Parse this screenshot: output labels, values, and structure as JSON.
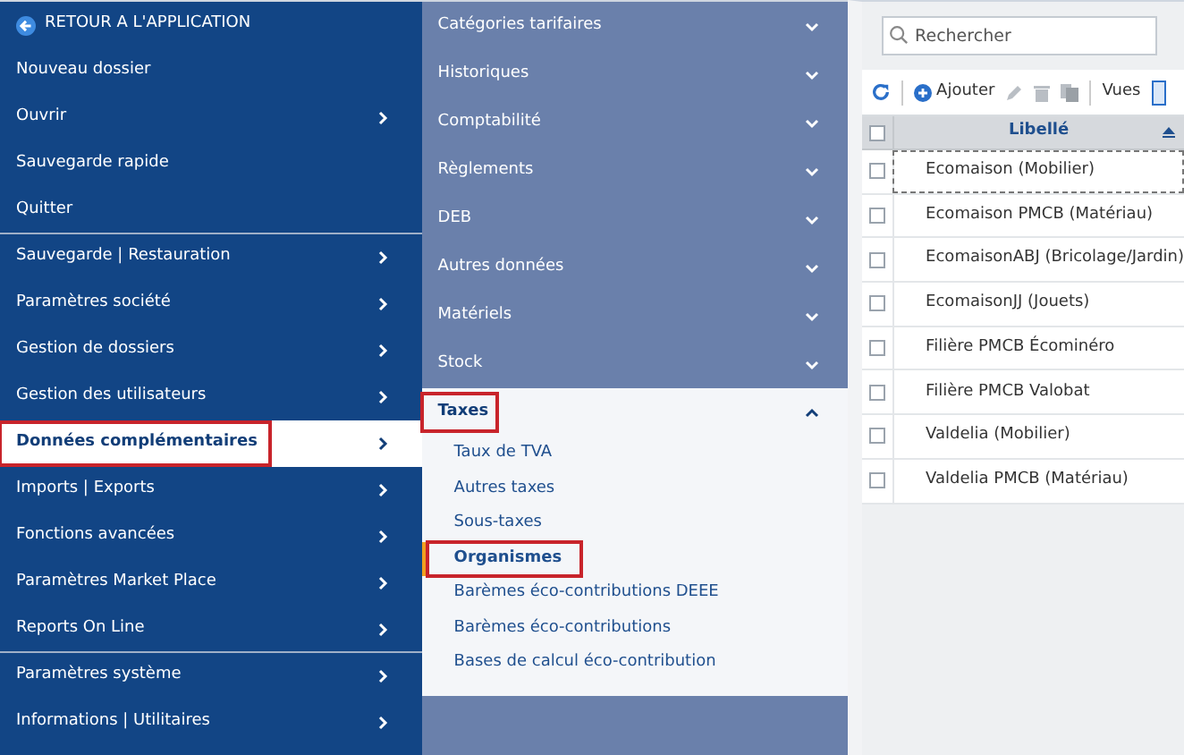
{
  "back_link": {
    "label": "RETOUR A L'APPLICATION"
  },
  "main_menu": [
    {
      "label": "Nouveau dossier",
      "has_submenu": false,
      "selected": false,
      "highlighted": false,
      "divider_after": false
    },
    {
      "label": "Ouvrir",
      "has_submenu": true,
      "selected": false,
      "highlighted": false,
      "divider_after": false
    },
    {
      "label": "Sauvegarde rapide",
      "has_submenu": false,
      "selected": false,
      "highlighted": false,
      "divider_after": false
    },
    {
      "label": "Quitter",
      "has_submenu": false,
      "selected": false,
      "highlighted": false,
      "divider_after": true
    },
    {
      "label": "Sauvegarde | Restauration",
      "has_submenu": true,
      "selected": false,
      "highlighted": false,
      "divider_after": false
    },
    {
      "label": "Paramètres société",
      "has_submenu": true,
      "selected": false,
      "highlighted": false,
      "divider_after": false
    },
    {
      "label": "Gestion de dossiers",
      "has_submenu": true,
      "selected": false,
      "highlighted": false,
      "divider_after": false
    },
    {
      "label": "Gestion des utilisateurs",
      "has_submenu": true,
      "selected": false,
      "highlighted": false,
      "divider_after": false
    },
    {
      "label": "Données complémentaires",
      "has_submenu": true,
      "selected": true,
      "highlighted": true,
      "divider_after": false
    },
    {
      "label": "Imports | Exports",
      "has_submenu": true,
      "selected": false,
      "highlighted": false,
      "divider_after": false
    },
    {
      "label": "Fonctions avancées",
      "has_submenu": true,
      "selected": false,
      "highlighted": false,
      "divider_after": false
    },
    {
      "label": "Paramètres Market Place",
      "has_submenu": true,
      "selected": false,
      "highlighted": false,
      "divider_after": false
    },
    {
      "label": "Reports On Line",
      "has_submenu": true,
      "selected": false,
      "highlighted": false,
      "divider_after": true
    },
    {
      "label": "Paramètres système",
      "has_submenu": true,
      "selected": false,
      "highlighted": false,
      "divider_after": false
    },
    {
      "label": "Informations | Utilitaires",
      "has_submenu": true,
      "selected": false,
      "highlighted": false,
      "divider_after": false
    }
  ],
  "submenu": [
    {
      "label": "Catégories tarifaires",
      "expanded": false,
      "highlighted": false
    },
    {
      "label": "Historiques",
      "expanded": false,
      "highlighted": false
    },
    {
      "label": "Comptabilité",
      "expanded": false,
      "highlighted": false
    },
    {
      "label": "Règlements",
      "expanded": false,
      "highlighted": false
    },
    {
      "label": "DEB",
      "expanded": false,
      "highlighted": false
    },
    {
      "label": "Autres données",
      "expanded": false,
      "highlighted": false
    },
    {
      "label": "Matériels",
      "expanded": false,
      "highlighted": false
    },
    {
      "label": "Stock",
      "expanded": false,
      "highlighted": false
    },
    {
      "label": "Taxes",
      "expanded": true,
      "highlighted": true,
      "children": [
        {
          "label": "Taux de TVA",
          "selected": false,
          "highlighted": false
        },
        {
          "label": "Autres taxes",
          "selected": false,
          "highlighted": false
        },
        {
          "label": "Sous-taxes",
          "selected": false,
          "highlighted": false
        },
        {
          "label": "Organismes",
          "selected": true,
          "highlighted": true
        },
        {
          "label": "Barèmes éco-contributions DEEE",
          "selected": false,
          "highlighted": false
        },
        {
          "label": "Barèmes éco-contributions",
          "selected": false,
          "highlighted": false
        },
        {
          "label": "Bases de calcul éco-contribution",
          "selected": false,
          "highlighted": false
        }
      ]
    }
  ],
  "search": {
    "placeholder": "Rechercher"
  },
  "toolbar": {
    "add_label": "Ajouter",
    "views_label": "Vues"
  },
  "table": {
    "all_checked": false,
    "columns": [
      "Libellé"
    ],
    "rows": [
      {
        "label": "Ecomaison (Mobilier)",
        "checked": false,
        "focused": true
      },
      {
        "label": "Ecomaison PMCB (Matériau)",
        "checked": false,
        "focused": false
      },
      {
        "label": "EcomaisonABJ (Bricolage/Jardin)",
        "checked": false,
        "focused": false
      },
      {
        "label": "EcomaisonJJ (Jouets)",
        "checked": false,
        "focused": false
      },
      {
        "label": "Filière PMCB Écominéro",
        "checked": false,
        "focused": false
      },
      {
        "label": "Filière PMCB Valobat",
        "checked": false,
        "focused": false
      },
      {
        "label": "Valdelia (Mobilier)",
        "checked": false,
        "focused": false
      },
      {
        "label": "Valdelia PMCB (Matériau)",
        "checked": false,
        "focused": false
      }
    ]
  }
}
